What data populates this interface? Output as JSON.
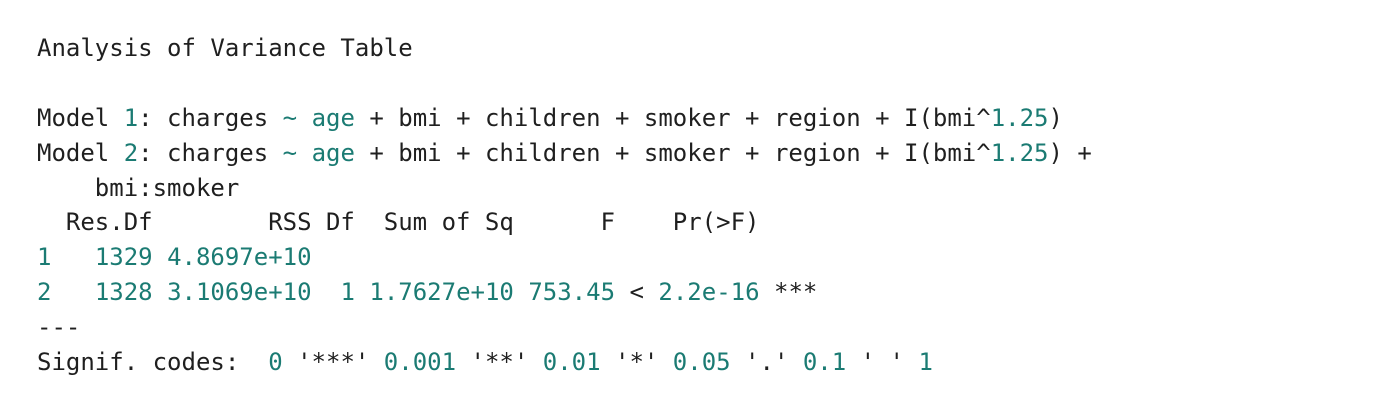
{
  "title": "Analysis of Variance Table",
  "model1": {
    "lead": "Model ",
    "num": "1",
    "rest1": ": charges ",
    "tilde": "~",
    "sp": " ",
    "age": "age",
    "rest2": " + bmi + children + smoker + region + I(bmi^",
    "pow": "1.25",
    "close": ")"
  },
  "model2": {
    "lead": "Model ",
    "num": "2",
    "rest1": ": charges ",
    "tilde": "~",
    "sp": " ",
    "age": "age",
    "rest2": " + bmi + children + smoker + region + I(bmi^",
    "pow": "1.25",
    "close": ") +"
  },
  "model2_cont": "    bmi:smoker",
  "header": "  Res.Df        RSS Df  Sum of Sq      F    Pr(>F)",
  "row1": {
    "idx": "1",
    "gap": "   ",
    "res_df": "1329",
    "sp1": " ",
    "rss": "4.8697e+10"
  },
  "row2": {
    "idx": "2",
    "gap": "   ",
    "res_df": "1328",
    "sp1": " ",
    "rss": "3.1069e+10",
    "sp2": "  ",
    "df": "1",
    "sp3": " ",
    "sumsq": "1.7627e+10",
    "sp4": " ",
    "f": "753.45",
    "lt": " < ",
    "p": "2.2e-16",
    "stars": " ***"
  },
  "separator": "---",
  "signif": {
    "label": "Signif. codes:  ",
    "c0": "0",
    "s1": " '***' ",
    "c1": "0.001",
    "s2": " '**' ",
    "c2": "0.01",
    "s3": " '*' ",
    "c3": "0.05",
    "s4": " '.' ",
    "c4": "0.1",
    "s5": " ' ' ",
    "c5": "1"
  },
  "colors": {
    "text": "#1f1f1f",
    "numeric": "#1b7b73",
    "background": "#ffffff"
  }
}
